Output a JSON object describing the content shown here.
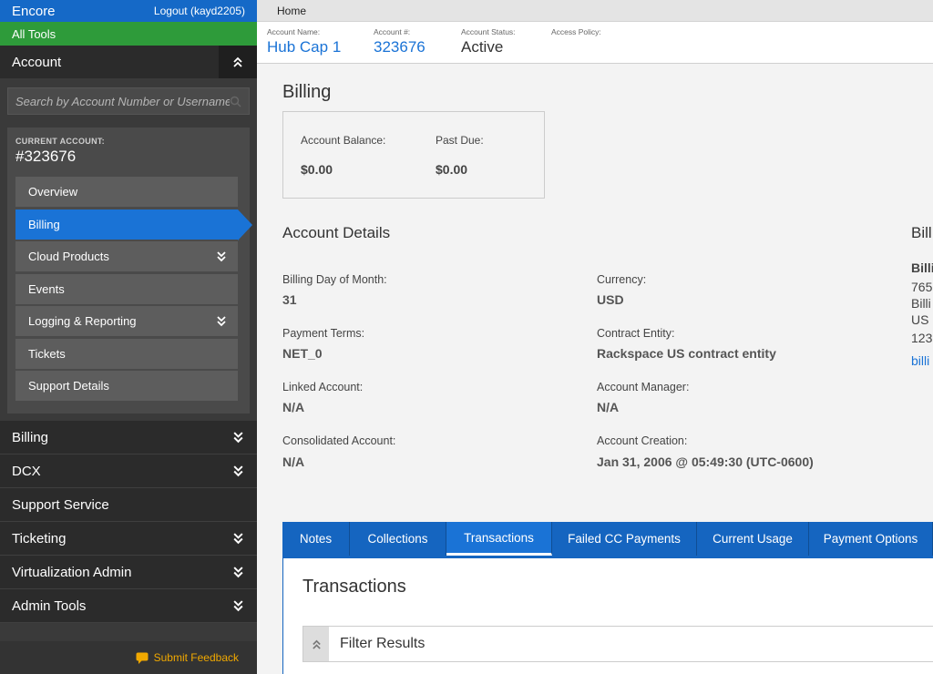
{
  "sidebar": {
    "brand": "Encore",
    "logout": "Logout (kayd2205)",
    "all_tools": "All Tools",
    "account_header": "Account",
    "search_placeholder": "Search by Account Number or Username",
    "current_account_caption": "CURRENT ACCOUNT:",
    "current_account_number": "#323676",
    "sub_items": [
      {
        "label": "Overview"
      },
      {
        "label": "Billing"
      },
      {
        "label": "Cloud Products"
      },
      {
        "label": "Events"
      },
      {
        "label": "Logging & Reporting"
      },
      {
        "label": "Tickets"
      },
      {
        "label": "Support Details"
      }
    ],
    "nav_items": [
      {
        "label": "Billing"
      },
      {
        "label": "DCX"
      },
      {
        "label": "Support Service"
      },
      {
        "label": "Ticketing"
      },
      {
        "label": "Virtualization Admin"
      },
      {
        "label": "Admin Tools"
      }
    ],
    "feedback": "Submit Feedback"
  },
  "breadcrumb": "Home",
  "account_bar": {
    "name_label": "Account Name:",
    "name_value": "Hub Cap 1",
    "number_label": "Account #:",
    "number_value": "323676",
    "status_label": "Account Status:",
    "status_value": "Active",
    "policy_label": "Access Policy:"
  },
  "billing": {
    "title": "Billing",
    "balance_label": "Account Balance:",
    "balance_value": "$0.00",
    "past_due_label": "Past Due:",
    "past_due_value": "$0.00"
  },
  "details": {
    "title": "Account Details",
    "billing_day_label": "Billing Day of Month:",
    "billing_day_value": "31",
    "payment_terms_label": "Payment Terms:",
    "payment_terms_value": "NET_0",
    "linked_label": "Linked Account:",
    "linked_value": "N/A",
    "consolidated_label": "Consolidated Account:",
    "consolidated_value": "N/A",
    "currency_label": "Currency:",
    "currency_value": "USD",
    "contract_label": "Contract Entity:",
    "contract_value": "Rackspace US contract entity",
    "manager_label": "Account Manager:",
    "manager_value": "N/A",
    "creation_label": "Account Creation:",
    "creation_value": "Jan 31, 2006 @ 05:49:30 (UTC-0600)"
  },
  "billing_contact": {
    "title": "Bill",
    "line1": "Billi",
    "line2": "765",
    "line3": "Billi",
    "line4": "US",
    "line5": "123",
    "link": "billi"
  },
  "tabs": [
    {
      "label": "Notes"
    },
    {
      "label": "Collections"
    },
    {
      "label": "Transactions"
    },
    {
      "label": "Failed CC Payments"
    },
    {
      "label": "Current Usage"
    },
    {
      "label": "Payment Options"
    }
  ],
  "panel": {
    "title": "Transactions",
    "filter_label": "Filter Results"
  },
  "colors": {
    "brand_blue": "#1569c7",
    "all_tools_green": "#2e9b3a",
    "feedback_orange": "#f0a800"
  }
}
